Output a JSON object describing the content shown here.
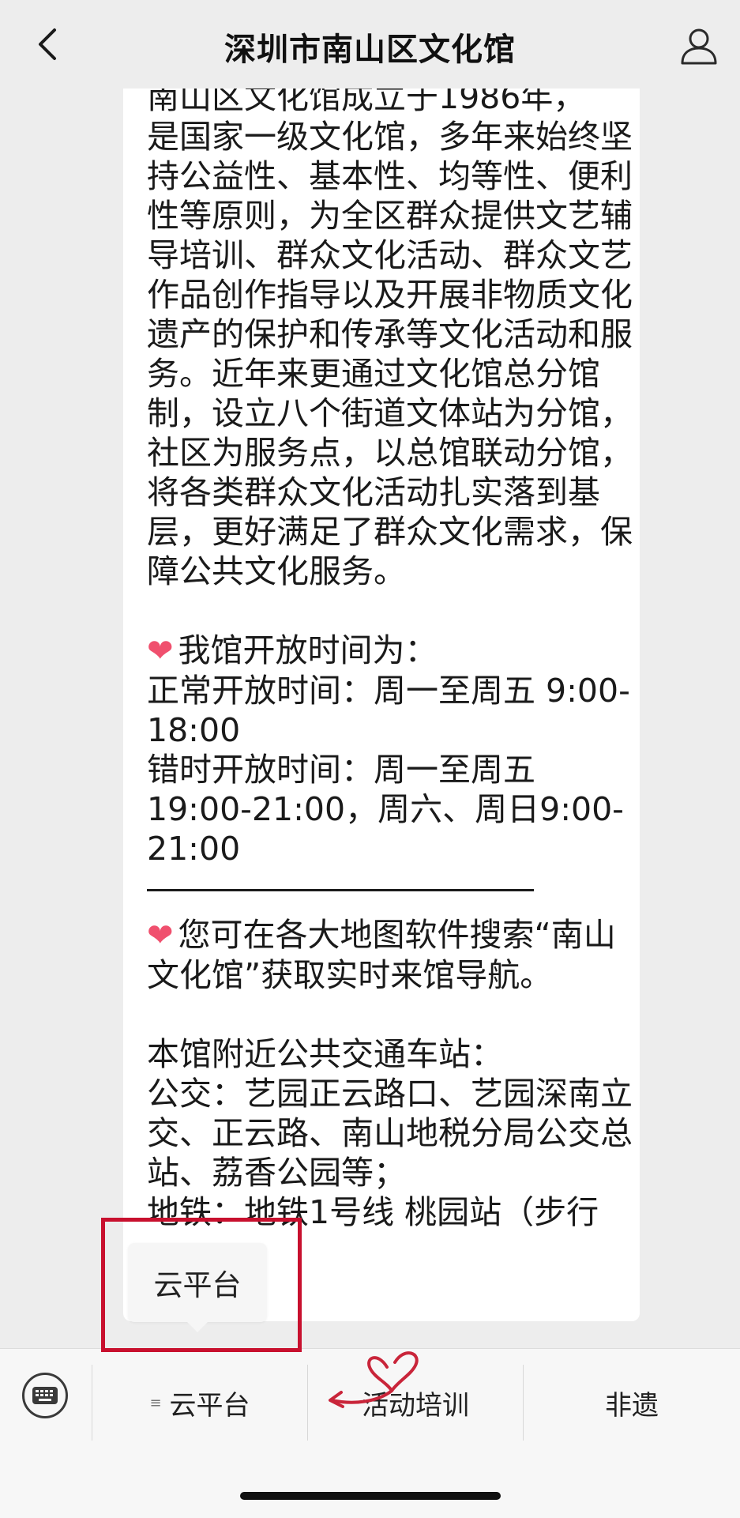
{
  "nav": {
    "title": "深圳市南山区文化馆",
    "back_icon": "chevron-left-icon",
    "user_icon": "user-icon"
  },
  "article": {
    "top_line": "南山区文化馆成立于1986年，",
    "intro": "是国家一级文化馆，多年来始终坚持公益性、基本性、均等性、便利性等原则，为全区群众提供文艺辅导培训、群众文化活动、群众文艺作品创作指导以及开展非物质文化遗产的保护和传承等文化活动和服务。近年来更通过文化馆总分馆制，设立八个街道文体站为分馆，社区为服务点，以总馆联动分馆，将各类群众文化活动扎实落到基层，更好满足了群众文化需求，保障公共文化服务。",
    "hours_heading": "我馆开放时间为：",
    "hours_normal": "正常开放时间：周一至周五 9:00-18:00",
    "hours_staggered": "错时开放时间：周一至周五19:00-21:00，周六、周日9:00-21:00",
    "nav_tip": "您可在各大地图软件搜索“南山文化馆”获取实时来馆导航。",
    "transit_heading": "本馆附近公共交通车站：",
    "transit_bus": "公交：艺园正云路口、艺园深南立交、正云路、南山地税分局公交总站、荔香公园等；",
    "transit_metro": "地铁：地铁1号线 桃园站（步行",
    "transit_end": "。"
  },
  "popup": {
    "label": "云平台"
  },
  "menu": {
    "keyboard_icon": "keyboard-icon",
    "items": [
      {
        "label": "云平台",
        "icon": "≡"
      },
      {
        "label": "活动培训"
      },
      {
        "label": "非遗"
      }
    ]
  },
  "colors": {
    "highlight": "#c8102e",
    "heart": "#f0506e",
    "decoration": "#c9253a"
  }
}
